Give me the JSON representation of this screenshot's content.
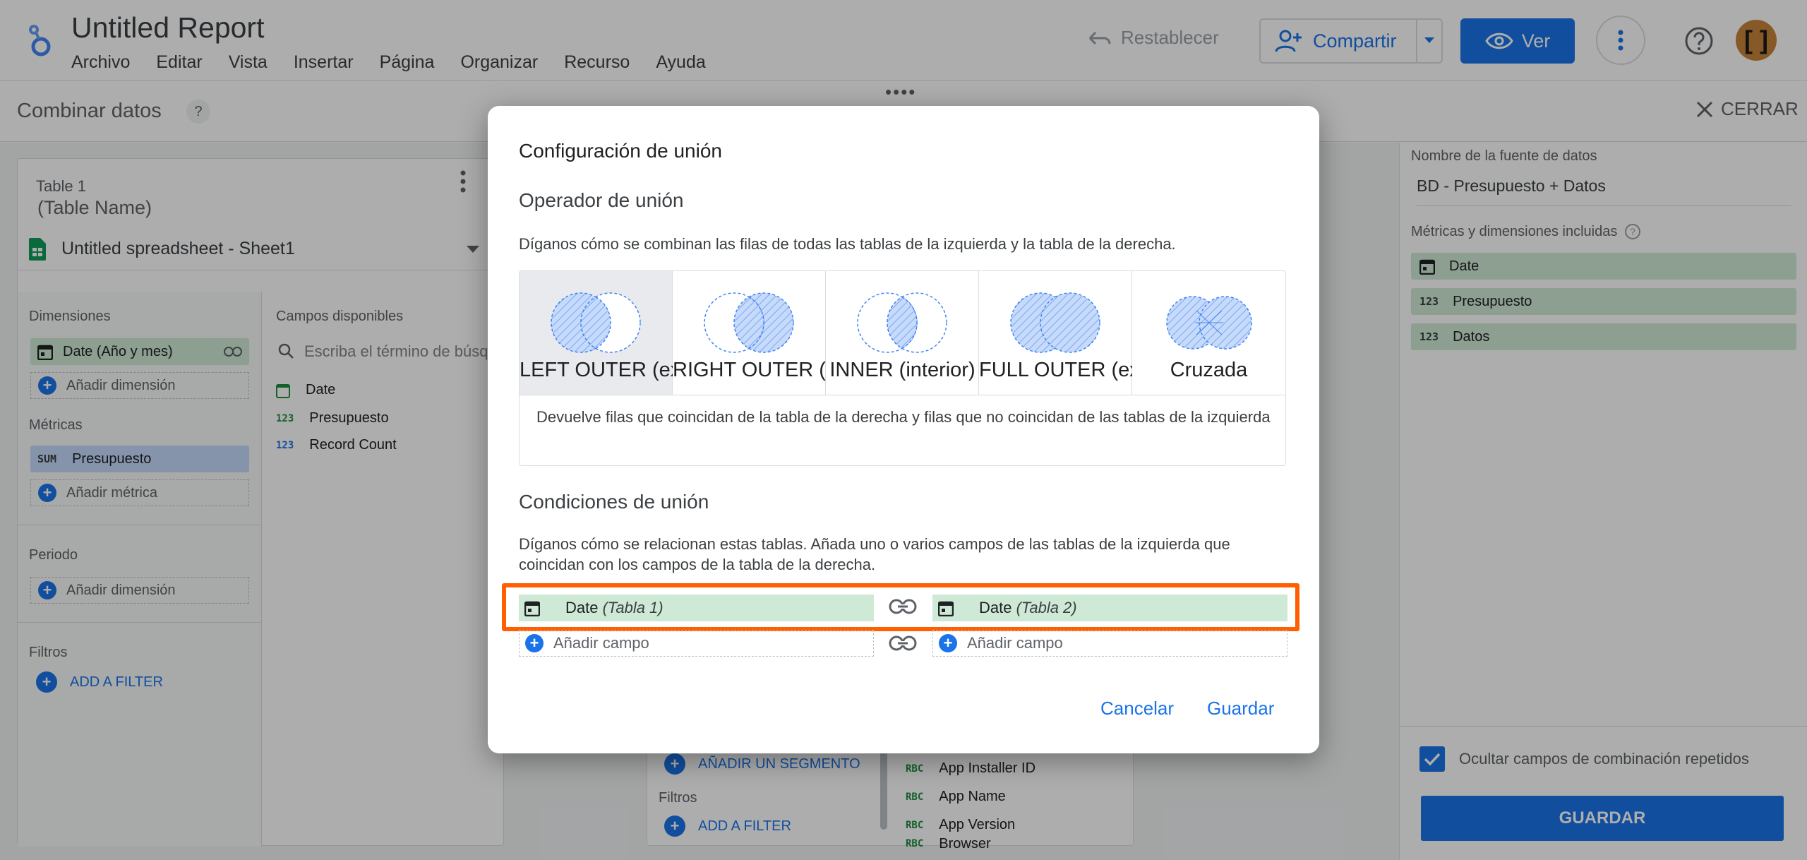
{
  "header": {
    "title": "Untitled Report",
    "menu": [
      "Archivo",
      "Editar",
      "Vista",
      "Insertar",
      "Página",
      "Organizar",
      "Recurso",
      "Ayuda"
    ],
    "reset_label": "Restablecer",
    "share_label": "Compartir",
    "view_label": "Ver",
    "avatar_text": "[ ]"
  },
  "subbar": {
    "title": "Combinar datos",
    "help": "?",
    "close_label": "CERRAR"
  },
  "left_panel": {
    "table_label": "Table 1",
    "table_name": "(Table Name)",
    "source": "Untitled spreadsheet - Sheet1",
    "dimensions_label": "Dimensiones",
    "dimension_item": "Date (Año y mes)",
    "add_dimension": "Añadir dimensión",
    "metrics_label": "Métricas",
    "metric_type": "SUM",
    "metric_item": "Presupuesto",
    "add_metric": "Añadir métrica",
    "period_label": "Periodo",
    "add_period_dimension": "Añadir dimensión",
    "filters_label": "Filtros",
    "add_filter": "ADD A FILTER",
    "available_label": "Campos disponibles",
    "search_placeholder": "Escriba el término de búsqueda",
    "fields": [
      {
        "type": "",
        "name": "Date"
      },
      {
        "type": "123",
        "name": "Presupuesto"
      },
      {
        "type": "123",
        "name": "Record Count"
      }
    ]
  },
  "middle_panel": {
    "add_segment": "AÑADIR UN SEGMENTO",
    "filters_label": "Filtros",
    "add_filter": "ADD A FILTER",
    "fields": [
      "App Installer ID",
      "App Name",
      "App Version",
      "Browser"
    ],
    "field_type": "RBC"
  },
  "right_panel": {
    "source_name_label": "Nombre de la fuente de datos",
    "source_name": "BD - Presupuesto + Datos",
    "included_label": "Métricas y dimensiones incluidas",
    "included": [
      {
        "type": "date",
        "name": "Date"
      },
      {
        "type": "123",
        "name": "Presupuesto"
      },
      {
        "type": "123",
        "name": "Datos"
      }
    ],
    "hide_label": "Ocultar campos de combinación repetidos",
    "save_label": "GUARDAR"
  },
  "dialog": {
    "title": "Configuración de unión",
    "operator_title": "Operador de unión",
    "operator_desc": "Díganos cómo se combinan las filas de todas las tablas de la izquierda y la tabla de la derecha.",
    "join_types": [
      {
        "label": "LEFT OUTER (externa izquierda)",
        "selected": true
      },
      {
        "label": "RIGHT OUTER (externa derecha)",
        "selected": false
      },
      {
        "label": "INNER (interior)",
        "selected": false
      },
      {
        "label": "FULL OUTER (externa completa)",
        "selected": false
      },
      {
        "label": "Cruzada",
        "selected": false
      }
    ],
    "join_desc": "Devuelve filas que coincidan de la tabla de la derecha y filas que no coincidan de las tablas de la izquierda",
    "conditions_title": "Condiciones de unión",
    "conditions_desc": "Díganos cómo se relacionan estas tablas. Añada uno o varios campos de las tablas de la izquierda que coincidan con los campos de la tabla de la derecha.",
    "left_field": "Date",
    "left_table": "(Tabla 1)",
    "right_field": "Date",
    "right_table": "(Tabla 2)",
    "add_field": "Añadir campo",
    "cancel_label": "Cancelar",
    "save_label": "Guardar"
  },
  "colors": {
    "accent": "#1a73e8",
    "highlight": "#ff5f00",
    "field_green": "#ceead6",
    "metric_blue": "#c6dafc"
  }
}
